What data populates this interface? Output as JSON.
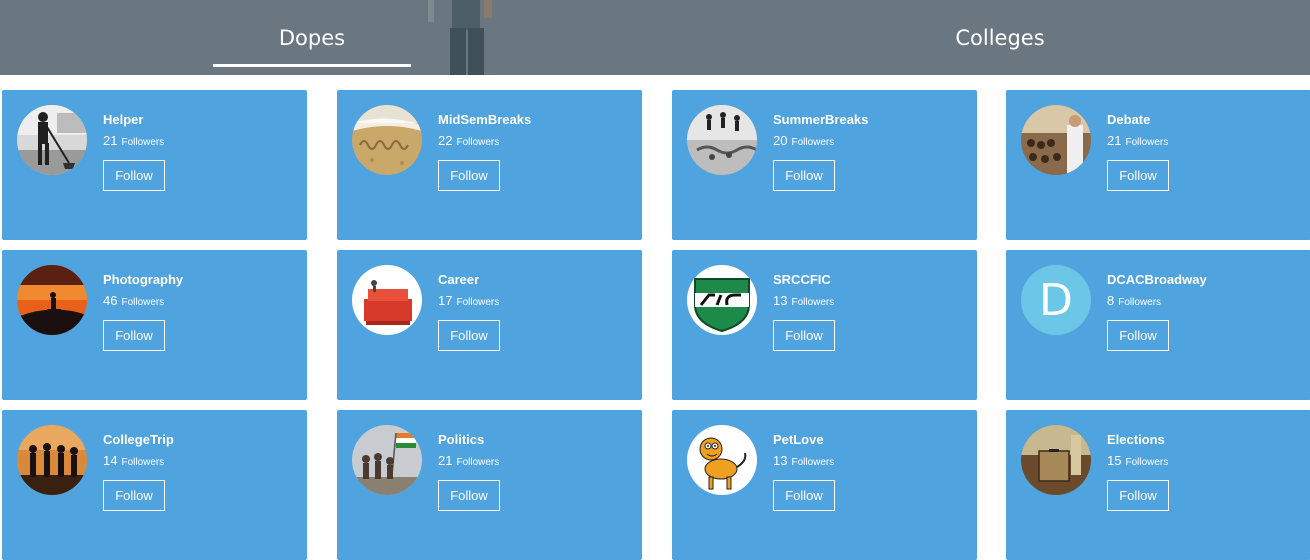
{
  "tabs": {
    "dopes": "Dopes",
    "colleges": "Colleges"
  },
  "follow_label": "Follow",
  "followers_label": "Followers",
  "colors": {
    "header": "#6a7680",
    "card": "#4fa3df",
    "text": "#ffffff"
  },
  "cards": [
    {
      "name": "Helper",
      "followers": "21",
      "avatar": "helper-avatar"
    },
    {
      "name": "MidSemBreaks",
      "followers": "22",
      "avatar": "holiday-sand-avatar"
    },
    {
      "name": "SummerBreaks",
      "followers": "20",
      "avatar": "jumping-people-avatar"
    },
    {
      "name": "Debate",
      "followers": "21",
      "avatar": "debate-hall-avatar"
    },
    {
      "name": "Photography",
      "followers": "46",
      "avatar": "sunset-photographer-avatar"
    },
    {
      "name": "Career",
      "followers": "17",
      "avatar": "career-letters-avatar"
    },
    {
      "name": "SRCCFIC",
      "followers": "13",
      "avatar": "fic-logo-avatar"
    },
    {
      "name": "DCACBroadway",
      "followers": "8",
      "avatar": "letter-d-avatar",
      "letter": "D"
    },
    {
      "name": "CollegeTrip",
      "followers": "14",
      "avatar": "friends-silhouette-avatar"
    },
    {
      "name": "Politics",
      "followers": "21",
      "avatar": "flag-crowd-avatar"
    },
    {
      "name": "PetLove",
      "followers": "13",
      "avatar": "cartoon-dog-avatar"
    },
    {
      "name": "Elections",
      "followers": "15",
      "avatar": "ballot-box-avatar"
    }
  ]
}
